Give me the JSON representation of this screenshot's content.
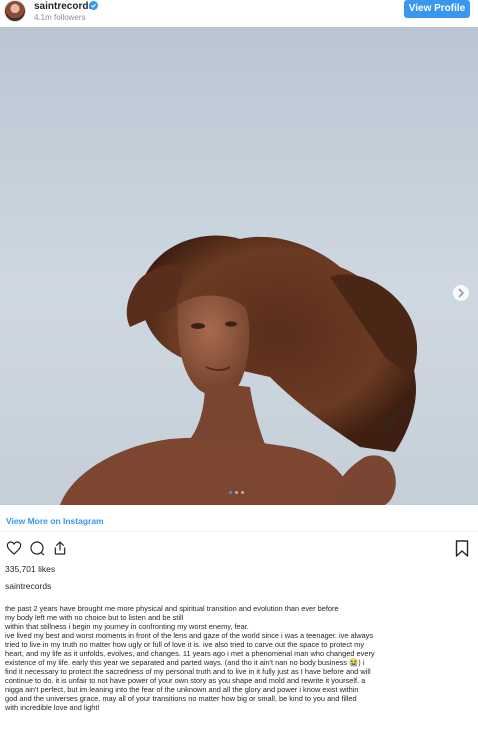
{
  "header": {
    "username": "saintrecords",
    "followers": "4.1m followers",
    "view_profile_label": "View Profile"
  },
  "post": {
    "view_more_label": "View More on Instagram",
    "likes": "335,701 likes",
    "author": "saintrecords",
    "caption_lines": [
      "the past 2 years have brought me more physical and spiritual transition and evolution than ever before",
      "my body left me with no choice but to listen and be still",
      "within that stillness i begin my journey in confronting my worst enemy, fear.",
      "ive lived my best and worst moments in front of the lens and gaze of the world since i was a teenager. ive always",
      "tried to live in my truth no matter how ugly or full of love it is. ive also tried to carve out the space to protect my",
      "heart, and my life as it unfolds, evolves, and changes. 11 years ago i met a phenomenal man who changed every",
      "existence of my life. early this year we separated and parted ways. (and tho it ain't nan no body business 😭) i",
      "find it necessary to protect the sacredness of my personal truth and to live in it fully just as I have before and will",
      "continue to do. it is unfair to not have power of your own story as you shape and mold and rewrite it yourself. a",
      "nigga ain't perfect, but im leaning into the fear of the unknown and all the glory and power i know exist within",
      "god and the universes grace. may all of your transitions no matter how big or small, be kind to you and filled",
      "with incredible love and light!"
    ]
  },
  "colors": {
    "accent": "#3897f0",
    "text": "#262626",
    "muted": "#8e8e8e"
  },
  "icons": [
    "verified-badge-icon",
    "chevron-right-icon",
    "heart-icon",
    "comment-icon",
    "share-icon",
    "bookmark-icon"
  ]
}
